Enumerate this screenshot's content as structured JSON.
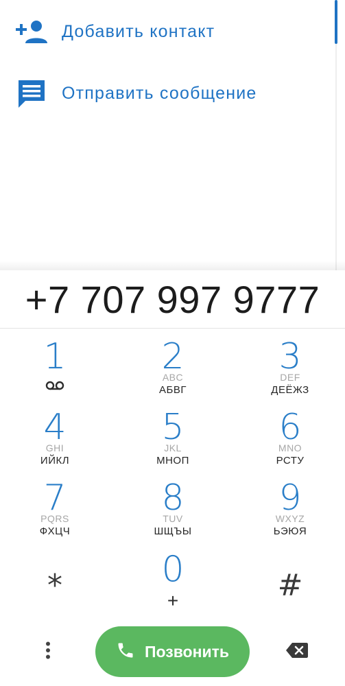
{
  "actions": {
    "add_contact": {
      "label": "Добавить контакт",
      "icon": "person-add-icon"
    },
    "send_message": {
      "label": "Отправить сообщение",
      "icon": "message-icon"
    }
  },
  "dialer": {
    "number": "+7 707 997 9777"
  },
  "keypad": {
    "keys": [
      {
        "digit": "1",
        "latin": "",
        "cyr": "",
        "icon": "voicemail-icon"
      },
      {
        "digit": "2",
        "latin": "ABC",
        "cyr": "АБВГ"
      },
      {
        "digit": "3",
        "latin": "DEF",
        "cyr": "ДЕЁЖЗ"
      },
      {
        "digit": "4",
        "latin": "GHI",
        "cyr": "ИЙКЛ"
      },
      {
        "digit": "5",
        "latin": "JKL",
        "cyr": "МНОП"
      },
      {
        "digit": "6",
        "latin": "MNO",
        "cyr": "РСТУ"
      },
      {
        "digit": "7",
        "latin": "PQRS",
        "cyr": "ФХЦЧ"
      },
      {
        "digit": "8",
        "latin": "TUV",
        "cyr": "ШЩЪЫ"
      },
      {
        "digit": "9",
        "latin": "WXYZ",
        "cyr": "ЬЭЮЯ"
      },
      {
        "symbol": "*"
      },
      {
        "digit": "0",
        "plus": "+"
      },
      {
        "symbol": "#"
      }
    ]
  },
  "bottom_bar": {
    "call_label": "Позвонить",
    "menu_icon": "more-vert-icon",
    "call_icon": "phone-icon",
    "backspace_icon": "backspace-icon"
  },
  "colors": {
    "accent_blue": "#1f73c4",
    "digit_blue": "#2a7ec8",
    "call_green": "#5bb860"
  }
}
